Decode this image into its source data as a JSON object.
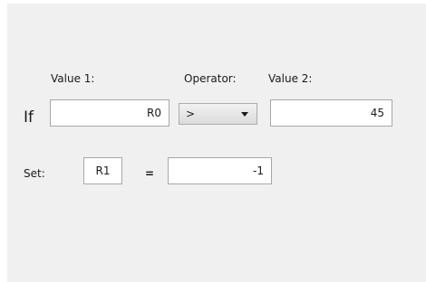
{
  "condition": {
    "if_label": "If",
    "value1_label": "Value 1:",
    "value1": "R0",
    "operator_label": "Operator:",
    "operator": ">",
    "value2_label": "Value 2:",
    "value2": "45"
  },
  "assignment": {
    "set_label": "Set:",
    "target": "R1",
    "equals": "=",
    "value": "-1"
  }
}
